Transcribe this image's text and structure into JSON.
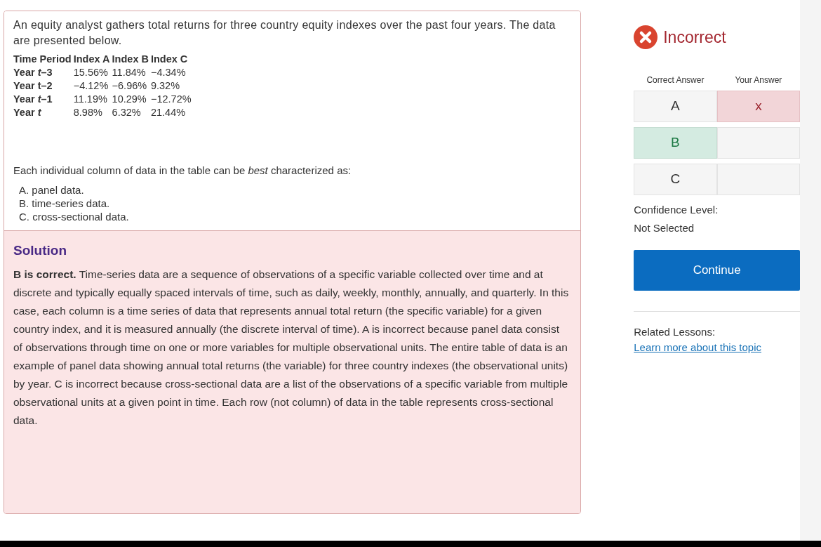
{
  "question": {
    "intro": "An equity analyst gathers total returns for three country equity indexes over the past four years. The data are presented below.",
    "table": {
      "columns": [
        "Time Period",
        "Index A",
        "Index B",
        "Index C"
      ],
      "rows": [
        [
          "Year *t*–3",
          "15.56%",
          "11.84%",
          "−4.34%"
        ],
        [
          "Year t–2",
          "−4.12%",
          "−6.96%",
          "9.32%"
        ],
        [
          "Year *t*–1",
          "11.19%",
          "10.29%",
          "−12.72%"
        ],
        [
          "Year *t*",
          "8.98%",
          "6.32%",
          "21.44%"
        ]
      ]
    },
    "prompt": "Each individual column of data in the table can be *best* characterized as:",
    "options": [
      "A. panel data.",
      "B. time-series data.",
      "C. cross-sectional data."
    ]
  },
  "solution": {
    "title": "Solution",
    "text": "**B is correct.** Time-series data are a sequence of observations of a specific variable collected over time and at discrete and typically equally spaced intervals of time, such as daily, weekly, monthly, annually, and quarterly. In this case, each column is a time series of data that represents annual total return (the specific variable) for a given country index, and it is measured annually (the discrete interval of time). A is incorrect because panel data consist of observations through time on one or more variables for multiple observational units. The entire table of data is an example of panel data showing annual total returns (the variable) for three country indexes (the observational units) by year. C is incorrect because cross-sectional data are a list of the observations of a specific variable from multiple observational units at a given point in time. Each row (not column) of data in the table represents cross-sectional data."
  },
  "result": {
    "status": "Incorrect",
    "correct": false,
    "headers": [
      "Correct Answer",
      "Your Answer"
    ],
    "answers": [
      {
        "option": "A",
        "correct": false,
        "chosen": true,
        "mark": "x"
      },
      {
        "option": "B",
        "correct": true,
        "chosen": false
      },
      {
        "option": "C",
        "correct": false,
        "chosen": false
      }
    ],
    "confidence_label": "Confidence Level:",
    "confidence_value": "Not Selected",
    "button": "Continue",
    "related_label": "Related Lessons:",
    "related_link": "Learn more about this topic"
  }
}
